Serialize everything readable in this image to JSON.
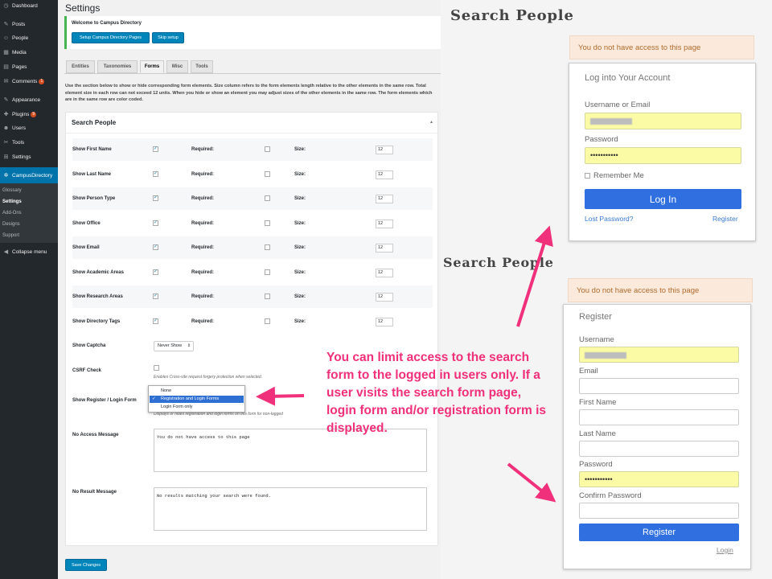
{
  "sidebar": {
    "items": [
      {
        "icon": "dashboard-icon",
        "glyph": "◷",
        "label": "Dashboard"
      },
      {
        "icon": "pin-icon",
        "glyph": "✎",
        "label": "Posts"
      },
      {
        "icon": "people-icon",
        "glyph": "☺",
        "label": "People"
      },
      {
        "icon": "media-icon",
        "glyph": "▦",
        "label": "Media"
      },
      {
        "icon": "pages-icon",
        "glyph": "▤",
        "label": "Pages"
      },
      {
        "icon": "comments-icon",
        "glyph": "✉",
        "label": "Comments",
        "badge": "1"
      },
      {
        "icon": "appearance-icon",
        "glyph": "✎",
        "label": "Appearance"
      },
      {
        "icon": "plugins-icon",
        "glyph": "✚",
        "label": "Plugins",
        "badge": "9"
      },
      {
        "icon": "users-icon",
        "glyph": "☻",
        "label": "Users"
      },
      {
        "icon": "tools-icon",
        "glyph": "✂",
        "label": "Tools"
      },
      {
        "icon": "settings-icon",
        "glyph": "⊞",
        "label": "Settings"
      },
      {
        "icon": "campus-directory-icon",
        "glyph": "✲",
        "label": "CampusDirectory"
      },
      {
        "icon": "collapse-icon",
        "glyph": "◀",
        "label": "Collapse menu"
      }
    ],
    "submenu": [
      "Glossary",
      "Settings",
      "Add-Ons",
      "Designs",
      "Support"
    ]
  },
  "main": {
    "title": "Settings",
    "notice": {
      "title": "Welcome to Campus Directory",
      "setup_btn": "Setup Campus Directory Pages",
      "skip_btn": "Skip setup"
    },
    "tabs": [
      "Entities",
      "Taxonomies",
      "Forms",
      "Misc",
      "Tools"
    ],
    "active_tab": "Forms",
    "description": "Use the section below to show or hide corresponding form elements. Size column refers to the form elements length relative to the other elements in the same row. Total element size in each row can not exceed 12 units. When you hide or show an element you may adjust sizes of the other elements in the same row. The form elements which are in the same row are color coded.",
    "panel_title": "Search People",
    "panel_toggle": "▴",
    "required_label": "Required:",
    "size_label": "Size:",
    "rows": [
      {
        "label": "Show First Name",
        "show": true,
        "required": false,
        "size": "12"
      },
      {
        "label": "Show Last Name",
        "show": true,
        "required": false,
        "size": "12"
      },
      {
        "label": "Show Person Type",
        "show": true,
        "required": false,
        "size": "12"
      },
      {
        "label": "Show Office",
        "show": true,
        "required": false,
        "size": "12"
      },
      {
        "label": "Show Email",
        "show": true,
        "required": false,
        "size": "12"
      },
      {
        "label": "Show Academic Areas",
        "show": true,
        "required": false,
        "size": "12"
      },
      {
        "label": "Show Research Areas",
        "show": true,
        "required": false,
        "size": "12"
      },
      {
        "label": "Show Directory Tags",
        "show": true,
        "required": false,
        "size": "12"
      }
    ],
    "captcha": {
      "label": "Show Captcha",
      "value": "Never Show"
    },
    "csrf": {
      "label": "CSRF Check",
      "hint": "Enables Cross-site request forgery protection when selected."
    },
    "register_login": {
      "label": "Show Register / Login Form",
      "hint": "Displays or hides registration and login forms on this form for non-logged",
      "options": [
        "None",
        "Registration and Login Forms",
        "Login Form only"
      ],
      "selected": "Registration and Login Forms"
    },
    "no_access": {
      "label": "No Access Message",
      "value": "You do not have access to this page"
    },
    "no_result": {
      "label": "No Result Message",
      "value": "No results matching your search were found."
    },
    "save_btn": "Save Changes"
  },
  "login_view": {
    "heading": "Search People",
    "alert": "You do not have access to this page",
    "card_title": "Log into Your Account",
    "username_label": "Username or Email",
    "password_label": "Password",
    "password_value": "•••••••••••",
    "remember": "Remember Me",
    "login_btn": "Log In",
    "lost_password": "Lost Password?",
    "register_link": "Register"
  },
  "register_view": {
    "heading": "Search People",
    "alert": "You do not have access to this page",
    "card_title": "Register",
    "username_label": "Username",
    "email_label": "Email",
    "first_name_label": "First Name",
    "last_name_label": "Last Name",
    "password_label": "Password",
    "password_value": "•••••••••••",
    "confirm_label": "Confirm Password",
    "register_btn": "Register",
    "login_link": "Login"
  },
  "callout": {
    "text": "You can limit access to the search form to the logged in users only. If a user visits the search form page, login form and/or registration form is displayed.",
    "color": "#f0307a"
  },
  "colors": {
    "wp_blue": "#0085ba",
    "sidebar_bg": "#23282d",
    "active_menu": "#0073aa",
    "btn_blue": "#2f6fe0",
    "alert_bg": "#fbeadc"
  }
}
